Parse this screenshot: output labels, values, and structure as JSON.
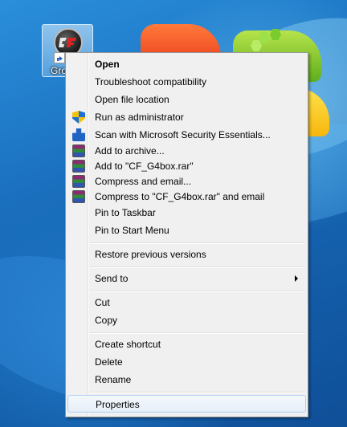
{
  "desktop": {
    "icon_label": "Gro"
  },
  "menu": {
    "items": [
      {
        "label": "Open",
        "bold": true,
        "icon": ""
      },
      {
        "label": "Troubleshoot compatibility",
        "icon": ""
      },
      {
        "label": "Open file location",
        "icon": ""
      },
      {
        "label": "Run as administrator",
        "icon": "uac-shield-icon"
      },
      {
        "label": "Scan with Microsoft Security Essentials...",
        "icon": "security-essentials-icon"
      },
      {
        "label": "Add to archive...",
        "icon": "winrar-icon"
      },
      {
        "label": "Add to \"CF_G4box.rar\"",
        "icon": "winrar-icon"
      },
      {
        "label": "Compress and email...",
        "icon": "winrar-icon"
      },
      {
        "label": "Compress to \"CF_G4box.rar\" and email",
        "icon": "winrar-icon"
      },
      {
        "label": "Pin to Taskbar",
        "icon": ""
      },
      {
        "label": "Pin to Start Menu",
        "icon": ""
      },
      {
        "label": "Restore previous versions",
        "icon": ""
      },
      {
        "label": "Send to",
        "icon": "",
        "submenu": true
      },
      {
        "label": "Cut",
        "icon": ""
      },
      {
        "label": "Copy",
        "icon": ""
      },
      {
        "label": "Create shortcut",
        "icon": ""
      },
      {
        "label": "Delete",
        "icon": ""
      },
      {
        "label": "Rename",
        "icon": ""
      },
      {
        "label": "Properties",
        "icon": "",
        "highlighted": true
      }
    ]
  },
  "colors": {
    "menu_bg": "#f0f0f0",
    "highlight_border": "#aecff7",
    "desktop_blue": "#1a72c2"
  }
}
